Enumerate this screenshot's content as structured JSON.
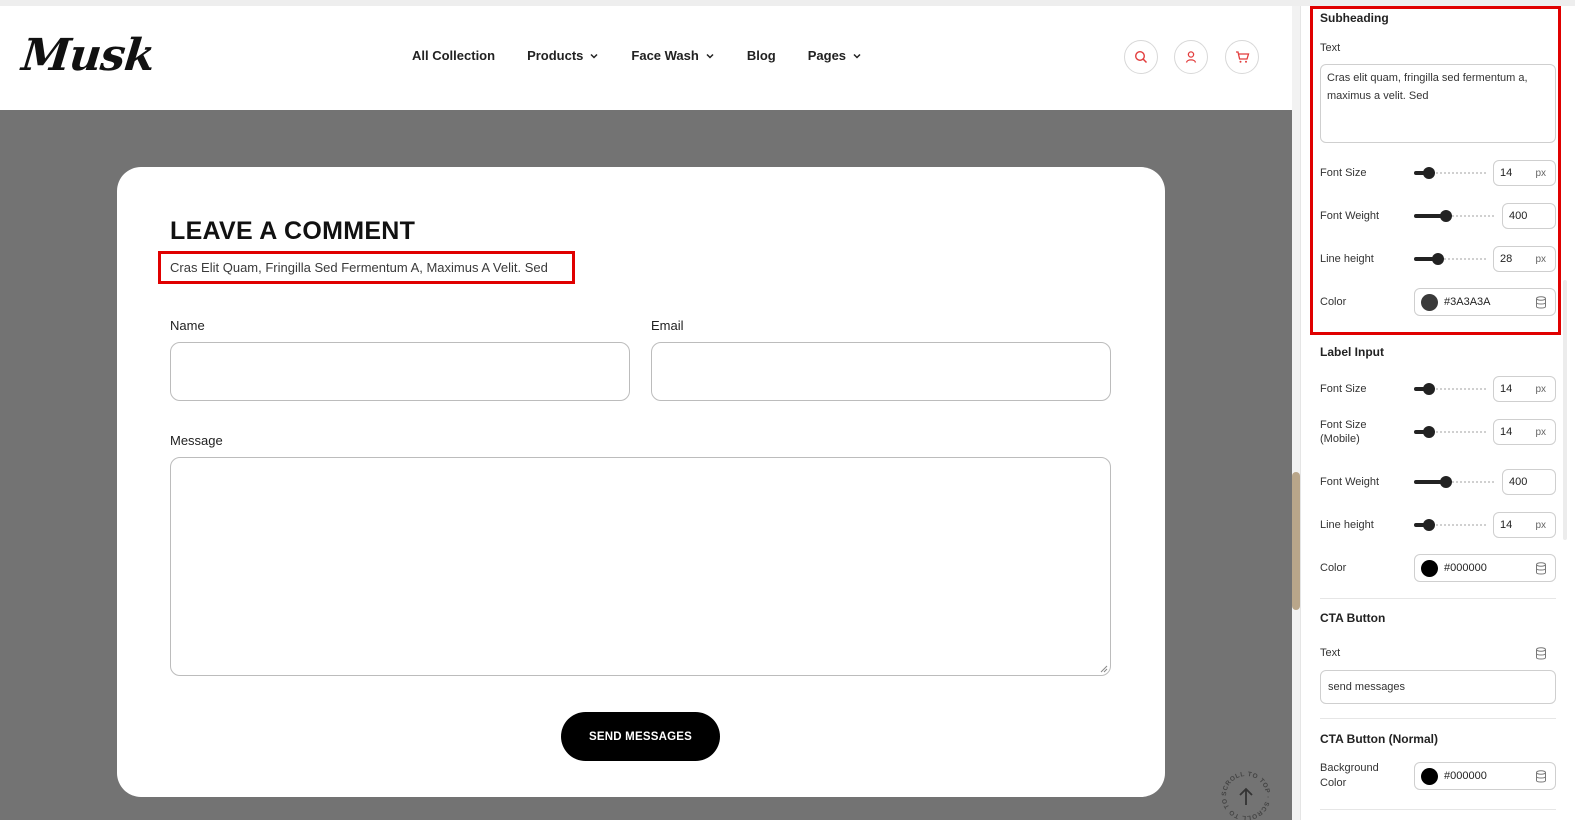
{
  "header": {
    "logo": "Musk",
    "nav": [
      "All Collection",
      "Products",
      "Face Wash",
      "Blog",
      "Pages"
    ]
  },
  "form": {
    "title": "LEAVE A COMMENT",
    "subheading": "Cras Elit Quam, Fringilla Sed Fermentum A, Maximus A Velit. Sed",
    "name_label": "Name",
    "email_label": "Email",
    "message_label": "Message",
    "button": "SEND MESSAGES",
    "scroll_top_text": "SCROLL TO TOP · SCROLL TO TOP ·"
  },
  "panel": {
    "subheading": {
      "title": "Subheading",
      "text_label": "Text",
      "text_value": "Cras elit quam, fringilla sed fermentum a, maximus a velit. Sed",
      "font_size_label": "Font Size",
      "font_size": "14",
      "font_weight_label": "Font Weight",
      "font_weight": "400",
      "line_height_label": "Line height",
      "line_height": "28",
      "color_label": "Color",
      "color": "#3A3A3A"
    },
    "label_input": {
      "title": "Label Input",
      "font_size_label": "Font Size",
      "font_size": "14",
      "font_size_mobile_label_1": "Font Size",
      "font_size_mobile_label_2": "(Mobile)",
      "font_size_mobile": "14",
      "font_weight_label": "Font Weight",
      "font_weight": "400",
      "line_height_label": "Line height",
      "line_height": "14",
      "color_label": "Color",
      "color": "#000000"
    },
    "cta": {
      "title": "CTA Button",
      "text_label": "Text",
      "text_value": "send messages"
    },
    "cta_normal": {
      "title": "CTA Button (Normal)",
      "bg_label_1": "Background",
      "bg_label_2": "Color",
      "bg_color": "#000000"
    },
    "unit": "px"
  },
  "colors": {
    "highlight": "#e00000",
    "overlay": "#737373",
    "accent_scroll": "#b9a68a"
  }
}
